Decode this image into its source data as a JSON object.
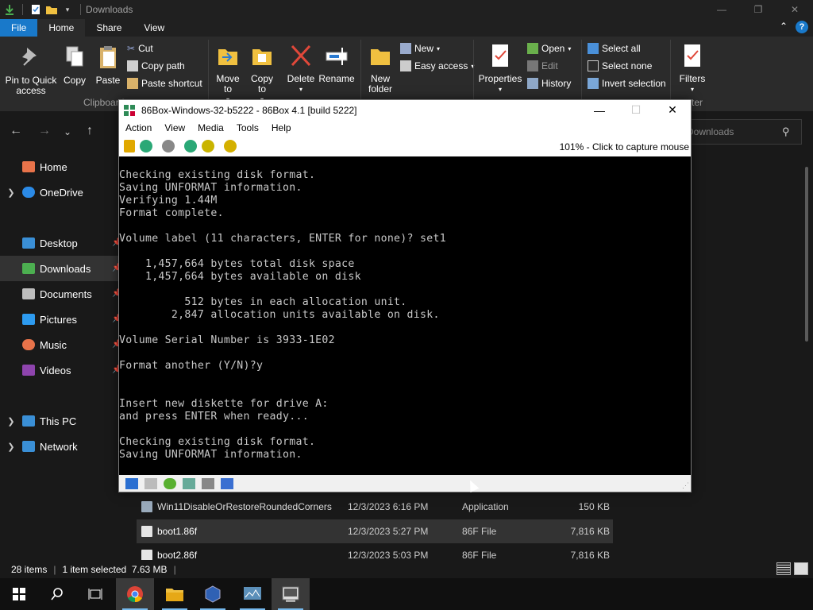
{
  "explorer": {
    "title": "Downloads",
    "window_controls": {
      "minimize": "—",
      "maximize": "❐",
      "close": "✕"
    },
    "tabs": [
      {
        "label": "File"
      },
      {
        "label": "Home"
      },
      {
        "label": "Share"
      },
      {
        "label": "View"
      }
    ],
    "ribbon": {
      "pin_label": "Pin to Quick access",
      "copy_label": "Copy",
      "paste_label": "Paste",
      "cut_label": "Cut",
      "copy_path_label": "Copy path",
      "paste_shortcut_label": "Paste shortcut",
      "clipboard_group": "Clipboard",
      "move_to_label": "Move to",
      "copy_to_label": "Copy to",
      "delete_label": "Delete",
      "rename_label": "Rename",
      "new_folder_label": "New folder",
      "new_item_label": "New",
      "easy_access_label": "Easy access",
      "properties_label": "Properties",
      "open_label": "Open",
      "edit_label": "Edit",
      "history_label": "History",
      "select_all_label": "Select all",
      "select_none_label": "Select none",
      "invert_selection_label": "Invert selection",
      "filters_label": "Filters",
      "filter_group_partial": "ter"
    },
    "search_placeholder": "Downloads",
    "sidebar": [
      {
        "label": "Home",
        "color": "#e8734a"
      },
      {
        "label": "OneDrive",
        "color": "#2b8ae6"
      },
      {
        "label": "Desktop",
        "color": "#3a8fd6"
      },
      {
        "label": "Downloads",
        "color": "#4caf50"
      },
      {
        "label": "Documents",
        "color": "#bdbdbd"
      },
      {
        "label": "Pictures",
        "color": "#2d9bf0"
      },
      {
        "label": "Music",
        "color": "#e8734a"
      },
      {
        "label": "Videos",
        "color": "#8e44ad"
      },
      {
        "label": "This PC",
        "color": "#3a8fd6"
      },
      {
        "label": "Network",
        "color": "#3a8fd6"
      }
    ],
    "files": [
      {
        "name": "Win11DisableOrRestoreRoundedCorners",
        "date": "12/3/2023 6:16 PM",
        "type": "Application",
        "size": "150 KB"
      },
      {
        "name": "boot1.86f",
        "date": "12/3/2023 5:27 PM",
        "type": "86F File",
        "size": "7,816 KB"
      },
      {
        "name": "boot2.86f",
        "date": "12/3/2023 5:03 PM",
        "type": "86F File",
        "size": "7,816 KB"
      }
    ],
    "status": {
      "items": "28 items",
      "selected": "1 item selected  7.63 MB"
    }
  },
  "vm": {
    "title": "86Box-Windows-32-b5222 - 86Box 4.1 [build 5222]",
    "menu": [
      "Action",
      "View",
      "Media",
      "Tools",
      "Help"
    ],
    "capture_text": "101% - Click to capture mouse",
    "screen_lines": [
      "Checking existing disk format.",
      "Saving UNFORMAT information.",
      "Verifying 1.44M",
      "Format complete.",
      "",
      "Volume label (11 characters, ENTER for none)? set1",
      "",
      "    1,457,664 bytes total disk space",
      "    1,457,664 bytes available on disk",
      "",
      "          512 bytes in each allocation unit.",
      "        2,847 allocation units available on disk.",
      "",
      "Volume Serial Number is 3933-1E02",
      "",
      "Format another (Y/N)?y",
      "",
      "",
      "Insert new diskette for drive A:",
      "and press ENTER when ready...",
      "",
      "Checking existing disk format.",
      "Saving UNFORMAT information."
    ]
  },
  "taskbar": {
    "items": [
      "start",
      "search",
      "task-view",
      "chrome",
      "file-explorer",
      "virtualbox",
      "resource-monitor",
      "86box"
    ]
  }
}
